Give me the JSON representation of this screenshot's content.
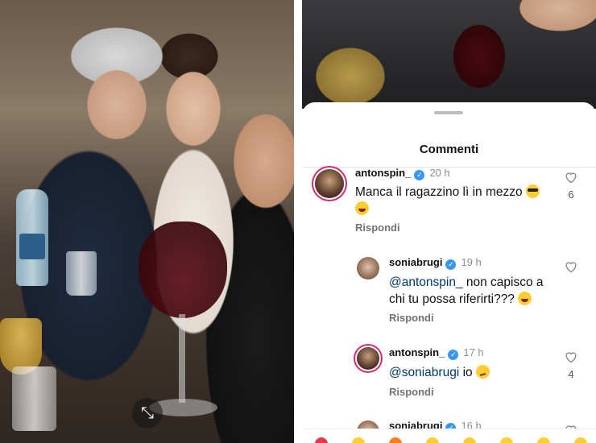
{
  "sheet": {
    "title": "Commenti"
  },
  "comments": [
    {
      "username": "antonspin_",
      "time": "20 h",
      "text": "Manca il ragazzino lì in mezzo",
      "reply_label": "Rispondi",
      "likes": "6"
    },
    {
      "username": "soniabrugi",
      "time": "19 h",
      "mention": "@antonspin_",
      "text_line1": " non capisco a",
      "text_line2": "chi tu possa riferirti???",
      "reply_label": "Rispondi"
    },
    {
      "username": "antonspin_",
      "time": "17 h",
      "mention": "@soniabrugi",
      "text": " io",
      "reply_label": "Rispondi",
      "likes": "4"
    },
    {
      "username": "soniabrugi",
      "time": "16 h"
    }
  ],
  "icons": {
    "expand": "expand-icon",
    "verified": "verified-badge-icon",
    "like": "heart-icon"
  },
  "colors": {
    "verified": "#3897f0",
    "mention": "#00376b",
    "story_ring": "#d62976"
  }
}
